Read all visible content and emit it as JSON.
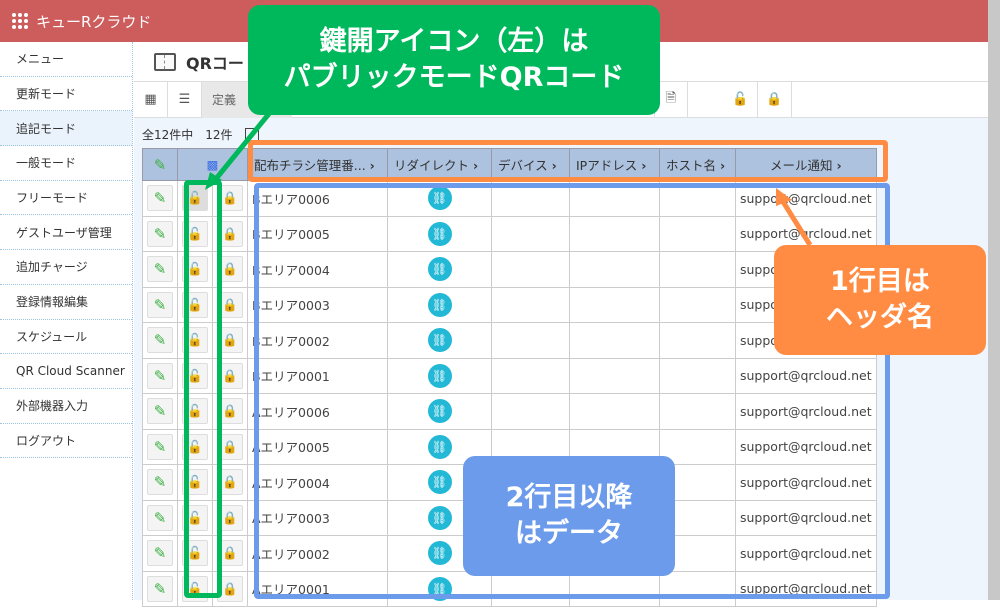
{
  "app": {
    "title": "キューRクラウド"
  },
  "sidebar": {
    "items": [
      {
        "label": "メニュー"
      },
      {
        "label": "更新モード"
      },
      {
        "label": "追記モード",
        "active": true
      },
      {
        "label": "一般モード"
      },
      {
        "label": "フリーモード"
      },
      {
        "label": "ゲストユーザ管理"
      },
      {
        "label": "追加チャージ"
      },
      {
        "label": "登録情報編集"
      },
      {
        "label": "スケジュール"
      },
      {
        "label": "QR Cloud Scanner"
      },
      {
        "label": "外部機器入力"
      },
      {
        "label": "ログアウト"
      }
    ]
  },
  "page": {
    "title": "QRコード",
    "tab_label": "定義"
  },
  "list": {
    "total_label": "全12件中",
    "shown_label": "12件"
  },
  "table": {
    "headers": [
      "配布チラシ管理番...",
      "リダイレクト",
      "デバイス",
      "IPアドレス",
      "ホスト名",
      "メール通知"
    ],
    "rows": [
      {
        "name": "Bエリア0006",
        "email": "support@qrcloud.net"
      },
      {
        "name": "Bエリア0005",
        "email": "support@qrcloud.net"
      },
      {
        "name": "Bエリア0004",
        "email": "support@qrcloud.net"
      },
      {
        "name": "Bエリア0003",
        "email": "support@qrcloud.net"
      },
      {
        "name": "Bエリア0002",
        "email": "support@qrcloud.net"
      },
      {
        "name": "Bエリア0001",
        "email": "support@qrcloud.net"
      },
      {
        "name": "Aエリア0006",
        "email": "support@qrcloud.net"
      },
      {
        "name": "Aエリア0005",
        "email": "support@qrcloud.net"
      },
      {
        "name": "Aエリア0004",
        "email": "support@qrcloud.net"
      },
      {
        "name": "Aエリア0003",
        "email": "support@qrcloud.net"
      },
      {
        "name": "Aエリア0002",
        "email": "support@qrcloud.net"
      },
      {
        "name": "Aエリア0001",
        "email": "support@qrcloud.net"
      }
    ]
  },
  "callouts": {
    "green": "鍵開アイコン（左）は\nパブリックモードQRコード",
    "orange": "1行目は\nヘッダ名",
    "blue": "2行目以降\nはデータ"
  },
  "colors": {
    "topbar": "#cd5c5c",
    "green": "#00b85c",
    "orange": "#ff8c42",
    "blue": "#6b9bea"
  }
}
